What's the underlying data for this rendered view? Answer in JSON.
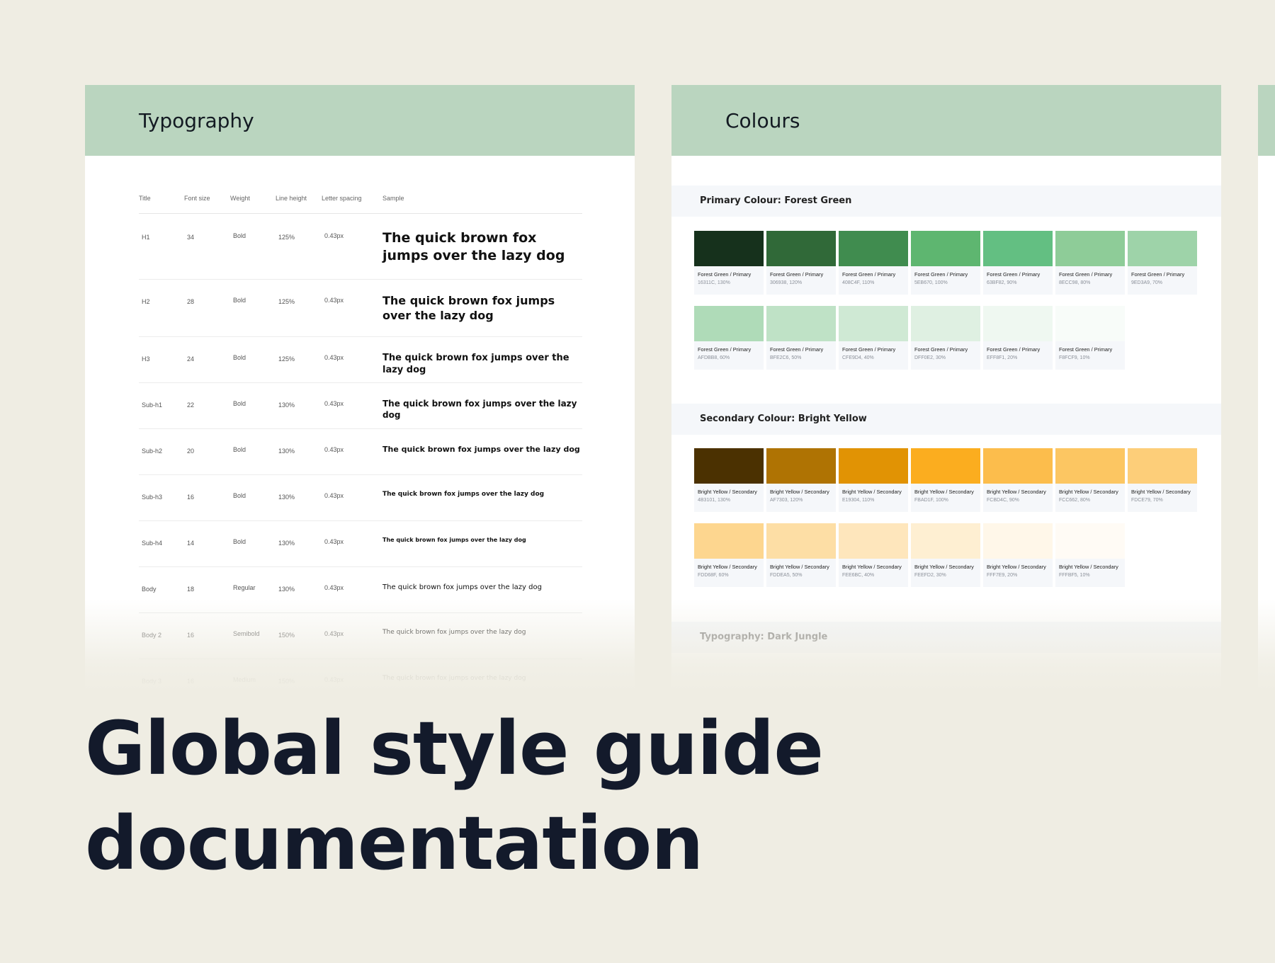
{
  "typography_panel": {
    "title": "Typography",
    "columns": [
      "Title",
      "Font size",
      "Weight",
      "Line height",
      "Letter spacing",
      "Sample"
    ],
    "rows": [
      {
        "title": "H1",
        "size": "34",
        "weight": "Bold",
        "line_height": "125%",
        "spacing": "0.43px",
        "sample": "The quick brown fox jumps over the lazy dog"
      },
      {
        "title": "H2",
        "size": "28",
        "weight": "Bold",
        "line_height": "125%",
        "spacing": "0.43px",
        "sample": "The quick brown fox jumps over the lazy dog"
      },
      {
        "title": "H3",
        "size": "24",
        "weight": "Bold",
        "line_height": "125%",
        "spacing": "0.43px",
        "sample": "The quick brown fox jumps over the lazy dog"
      },
      {
        "title": "Sub-h1",
        "size": "22",
        "weight": "Bold",
        "line_height": "130%",
        "spacing": "0.43px",
        "sample": "The quick brown fox jumps over the lazy dog"
      },
      {
        "title": "Sub-h2",
        "size": "20",
        "weight": "Bold",
        "line_height": "130%",
        "spacing": "0.43px",
        "sample": "The quick brown fox jumps over the lazy dog"
      },
      {
        "title": "Sub-h3",
        "size": "16",
        "weight": "Bold",
        "line_height": "130%",
        "spacing": "0.43px",
        "sample": "The quick brown fox jumps over the lazy dog"
      },
      {
        "title": "Sub-h4",
        "size": "14",
        "weight": "Bold",
        "line_height": "130%",
        "spacing": "0.43px",
        "sample": "The quick brown fox jumps over the lazy dog"
      },
      {
        "title": "Body",
        "size": "18",
        "weight": "Regular",
        "line_height": "130%",
        "spacing": "0.43px",
        "sample": "The quick brown fox jumps over the lazy dog"
      },
      {
        "title": "Body 2",
        "size": "16",
        "weight": "Semibold",
        "line_height": "150%",
        "spacing": "0.43px",
        "sample": "The quick brown fox jumps over the lazy dog"
      },
      {
        "title": "Body 3",
        "size": "16",
        "weight": "Medium",
        "line_height": "150%",
        "spacing": "0.43px",
        "sample": "The quick brown fox jumps over the lazy dog"
      }
    ]
  },
  "colours_panel": {
    "title": "Colours",
    "primary_label": "Primary Colour: Forest Green",
    "primary_swatches": [
      {
        "name": "Forest Green / Primary",
        "hex": "16311C, 130%",
        "color": "#16311c"
      },
      {
        "name": "Forest Green / Primary",
        "hex": "306938, 120%",
        "color": "#306938"
      },
      {
        "name": "Forest Green / Primary",
        "hex": "408C4F, 110%",
        "color": "#408c4f"
      },
      {
        "name": "Forest Green / Primary",
        "hex": "5EB670, 100%",
        "color": "#5eb670"
      },
      {
        "name": "Forest Green / Primary",
        "hex": "63BF82, 90%",
        "color": "#63bf82"
      },
      {
        "name": "Forest Green / Primary",
        "hex": "8ECC98, 80%",
        "color": "#8ecc98"
      },
      {
        "name": "Forest Green / Primary",
        "hex": "9ED3A9, 70%",
        "color": "#9ed3a9"
      },
      {
        "name": "Forest Green / Primary",
        "hex": "AFDBB8, 60%",
        "color": "#afdbb8"
      },
      {
        "name": "Forest Green / Primary",
        "hex": "BFE2C6, 50%",
        "color": "#bfe2c6"
      },
      {
        "name": "Forest Green / Primary",
        "hex": "CFE9D4, 40%",
        "color": "#cfe9d4"
      },
      {
        "name": "Forest Green / Primary",
        "hex": "DFF0E2, 30%",
        "color": "#dff0e2"
      },
      {
        "name": "Forest Green / Primary",
        "hex": "EFF8F1, 20%",
        "color": "#eff8f1"
      },
      {
        "name": "Forest Green / Primary",
        "hex": "F8FCF9, 10%",
        "color": "#f8fcf9"
      }
    ],
    "secondary_label": "Secondary Colour: Bright Yellow",
    "secondary_swatches": [
      {
        "name": "Bright Yellow / Secondary",
        "hex": "4B3101, 130%",
        "color": "#4b3101"
      },
      {
        "name": "Bright Yellow / Secondary",
        "hex": "AF7303, 120%",
        "color": "#af7303"
      },
      {
        "name": "Bright Yellow / Secondary",
        "hex": "E19304, 110%",
        "color": "#e19304"
      },
      {
        "name": "Bright Yellow / Secondary",
        "hex": "FBAD1F, 100%",
        "color": "#fbad1f"
      },
      {
        "name": "Bright Yellow / Secondary",
        "hex": "FCBD4C, 90%",
        "color": "#fcbd4c"
      },
      {
        "name": "Bright Yellow / Secondary",
        "hex": "FCC662, 80%",
        "color": "#fcc662"
      },
      {
        "name": "Bright Yellow / Secondary",
        "hex": "FDCE79, 70%",
        "color": "#fdce79"
      },
      {
        "name": "Bright Yellow / Secondary",
        "hex": "FDD68F, 60%",
        "color": "#fdd68f"
      },
      {
        "name": "Bright Yellow / Secondary",
        "hex": "FDDEA5, 50%",
        "color": "#fddea5"
      },
      {
        "name": "Bright Yellow / Secondary",
        "hex": "FEE6BC, 40%",
        "color": "#fee6bc"
      },
      {
        "name": "Bright Yellow / Secondary",
        "hex": "FEEFD2, 30%",
        "color": "#feefd2"
      },
      {
        "name": "Bright Yellow / Secondary",
        "hex": "FFF7E9, 20%",
        "color": "#fff7e9"
      },
      {
        "name": "Bright Yellow / Secondary",
        "hex": "FFFBF5, 10%",
        "color": "#fffbf5"
      }
    ],
    "tertiary_label": "Typography: Dark Jungle"
  },
  "headline": {
    "line1": "Global style guide",
    "line2": "documentation"
  },
  "colors": {
    "background": "#efede3",
    "panel_header": "#bad5bf",
    "headline_text": "#131a2b"
  }
}
